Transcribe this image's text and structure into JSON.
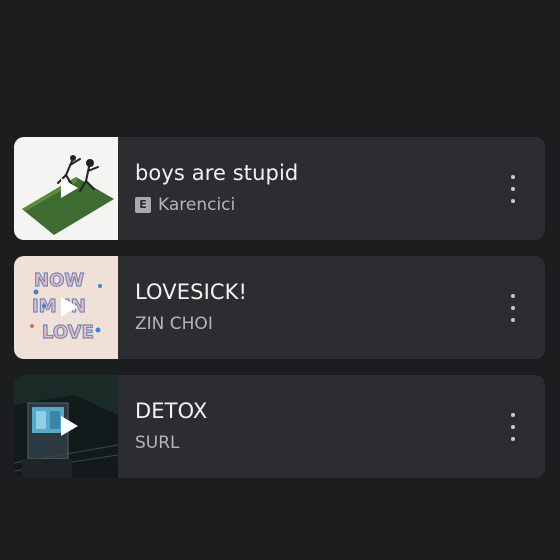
{
  "tracks": [
    {
      "title": "boys are stupid",
      "artist": "Karencici",
      "explicit": true,
      "explicit_label": "E",
      "thumbnail": "album-art-boys-are-stupid",
      "menu_icon": "more-vert-icon"
    },
    {
      "title": "LOVESICK!",
      "artist": "ZIN CHOI",
      "explicit": false,
      "thumbnail": "album-art-lovesick",
      "menu_icon": "more-vert-icon"
    },
    {
      "title": "DETOX",
      "artist": "SURL",
      "explicit": false,
      "thumbnail": "album-art-detox",
      "menu_icon": "more-vert-icon"
    }
  ],
  "colors": {
    "background": "#1b1d1f",
    "card": "#2b2d30",
    "title": "#f2f2f2",
    "subtitle": "#b3b5b8"
  }
}
